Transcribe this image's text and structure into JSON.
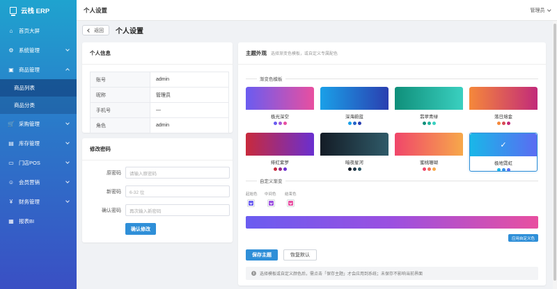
{
  "app": {
    "logo_text": "云栈 ERP"
  },
  "sidebar": {
    "items": [
      {
        "label": "首页大屏",
        "icon": "home-icon",
        "glyph": "⌂"
      },
      {
        "label": "系统管理",
        "icon": "gear-icon",
        "glyph": "⚙"
      },
      {
        "label": "商品管理",
        "icon": "box-icon",
        "glyph": "▣"
      },
      {
        "label": "采购管理",
        "icon": "cart-icon",
        "glyph": "🛒"
      },
      {
        "label": "库存管理",
        "icon": "warehouse-icon",
        "glyph": "▤"
      },
      {
        "label": "门店POS",
        "icon": "store-icon",
        "glyph": "▭"
      },
      {
        "label": "会员营销",
        "icon": "member-icon",
        "glyph": "☺"
      },
      {
        "label": "财务管理",
        "icon": "finance-icon",
        "glyph": "¥"
      },
      {
        "label": "报表BI",
        "icon": "report-icon",
        "glyph": "▦"
      }
    ],
    "sub_items": [
      {
        "label": "商品列表"
      },
      {
        "label": "商品分类"
      }
    ]
  },
  "topbar": {
    "title": "个人设置",
    "user": "管理员"
  },
  "page": {
    "back_label": "返回",
    "title": "个人设置"
  },
  "profile": {
    "title": "个人信息",
    "rows": [
      {
        "key": "账号",
        "value": "admin"
      },
      {
        "key": "昵称",
        "value": "管理员"
      },
      {
        "key": "手机号",
        "value": "—"
      },
      {
        "key": "角色",
        "value": "admin"
      }
    ]
  },
  "password": {
    "title": "修改密码",
    "fields": [
      {
        "label": "原密码",
        "placeholder": "请输入原密码"
      },
      {
        "label": "新密码",
        "placeholder": "6-32 位"
      },
      {
        "label": "确认密码",
        "placeholder": "再次输入新密码"
      }
    ],
    "submit_label": "确认修改"
  },
  "theme": {
    "title": "主题外观",
    "subtitle": "选择渐变色模板，或自定义专属配色",
    "templates_label": "渐变色模板",
    "templates": [
      {
        "name": "极光深空",
        "from": "#6a5cf0",
        "to": "#e84fa0",
        "dots": [
          "#6a5cf0",
          "#a35ad8",
          "#e84fa0"
        ]
      },
      {
        "name": "深海蔚蓝",
        "from": "#1aa0e8",
        "to": "#2a3fb0",
        "dots": [
          "#1aa0e8",
          "#2563c9",
          "#2a3fb0"
        ]
      },
      {
        "name": "翡翠青绿",
        "from": "#0f8f7a",
        "to": "#3ad0c0",
        "dots": [
          "#0f8f7a",
          "#22b39d",
          "#3ad0c0"
        ]
      },
      {
        "name": "落日熔金",
        "from": "#f5883a",
        "to": "#c22a7a",
        "dots": [
          "#f5883a",
          "#d64a56",
          "#c22a7a"
        ]
      },
      {
        "name": "绯红紫罗",
        "from": "#c82a3c",
        "to": "#6a2fd0",
        "dots": [
          "#c82a3c",
          "#9a2c86",
          "#6a2fd0"
        ]
      },
      {
        "name": "暗夜星河",
        "from": "#141c26",
        "to": "#2f5a68",
        "dots": [
          "#141c26",
          "#22384a",
          "#2f5a68"
        ]
      },
      {
        "name": "蜜桃珊瑚",
        "from": "#f0466a",
        "to": "#f7a84a",
        "dots": [
          "#f0466a",
          "#f46f5a",
          "#f7a84a"
        ]
      },
      {
        "name": "极地霓虹",
        "from": "#19b7e8",
        "to": "#5a6cf2",
        "dots": [
          "#19b7e8",
          "#3592ec",
          "#5a6cf2"
        ],
        "selected": true
      }
    ],
    "custom_label": "自定义渐变",
    "custom": {
      "start_label": "起始色",
      "mid_label": "中间色",
      "end_label": "结束色",
      "start": "#6a5cf0",
      "mid": "#9b4fe0",
      "end": "#e84fa0"
    },
    "apply_label": "应用自定义色",
    "save_label": "保存主题",
    "reset_label": "恢复默认",
    "tip": "选择模板或自定义颜色后，需点击「保存主题」才会应用到系统；未保存不影响当前界面"
  },
  "colors": {
    "accent": "#2f8fd8"
  }
}
